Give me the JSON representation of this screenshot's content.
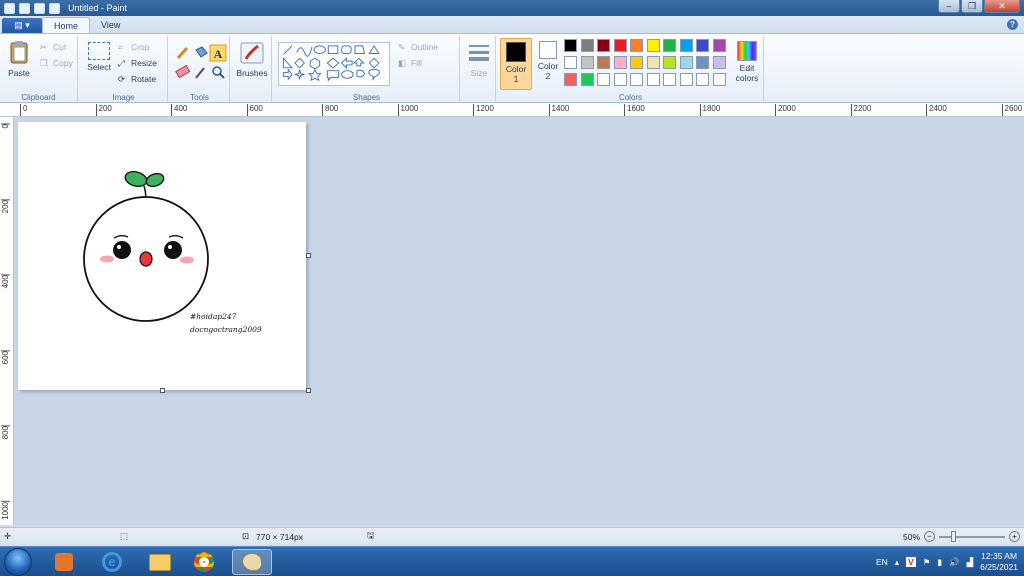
{
  "window": {
    "title": "Untitled - Paint"
  },
  "titlebar": {
    "minimize": "–",
    "maximize": "❐",
    "close": "✕"
  },
  "tabs": {
    "file": "▤ ▾",
    "home": "Home",
    "view": "View",
    "help": "?"
  },
  "clipboard": {
    "paste": "Paste",
    "cut": "Cut",
    "copy": "Copy",
    "label": "Clipboard"
  },
  "image": {
    "select": "Select",
    "crop": "Crop",
    "resize": "Resize",
    "rotate": "Rotate",
    "label": "Image"
  },
  "tools": {
    "label": "Tools"
  },
  "brushes": {
    "label": "Brushes"
  },
  "shapes": {
    "outline": "Outline",
    "fill": "Fill",
    "label": "Shapes"
  },
  "size": {
    "label": "Size"
  },
  "colors": {
    "color1": "Color 1",
    "color2": "Color 2",
    "edit": "Edit colors",
    "label": "Colors",
    "color1_value": "#000000",
    "color2_value": "#ffffff",
    "palette_row1": [
      "#000000",
      "#7f7f7f",
      "#880015",
      "#ed1c24",
      "#ff7f27",
      "#fff200",
      "#22b14c",
      "#00a2e8",
      "#3f48cc",
      "#a349a4"
    ],
    "palette_row2": [
      "#ffffff",
      "#c3c3c3",
      "#b97a57",
      "#ffaec9",
      "#ffc90e",
      "#efe4b0",
      "#b5e61d",
      "#99d9ea",
      "#7092be",
      "#c8bfe7"
    ],
    "palette_row3": [
      "#ef6262",
      "#22c55e",
      "#ffffff",
      "#ffffff",
      "#ffffff",
      "#ffffff",
      "#ffffff",
      "#ffffff",
      "#ffffff",
      "#ffffff"
    ]
  },
  "ruler": {
    "h_ticks": [
      "0",
      "200",
      "400",
      "600",
      "800",
      "1000",
      "1200",
      "1400",
      "1600",
      "1800",
      "2000",
      "2200",
      "2400",
      "2600"
    ],
    "v_ticks": [
      "0",
      "200",
      "400",
      "600",
      "800",
      "1000"
    ]
  },
  "canvas_text": {
    "line1": "#hoidap247",
    "line2": "docngoctrang2009"
  },
  "status": {
    "dimensions": "770 × 714px",
    "zoom": "50%"
  },
  "taskbar": {
    "lang": "EN",
    "time": "12:35 AM",
    "date": "6/25/2021"
  }
}
